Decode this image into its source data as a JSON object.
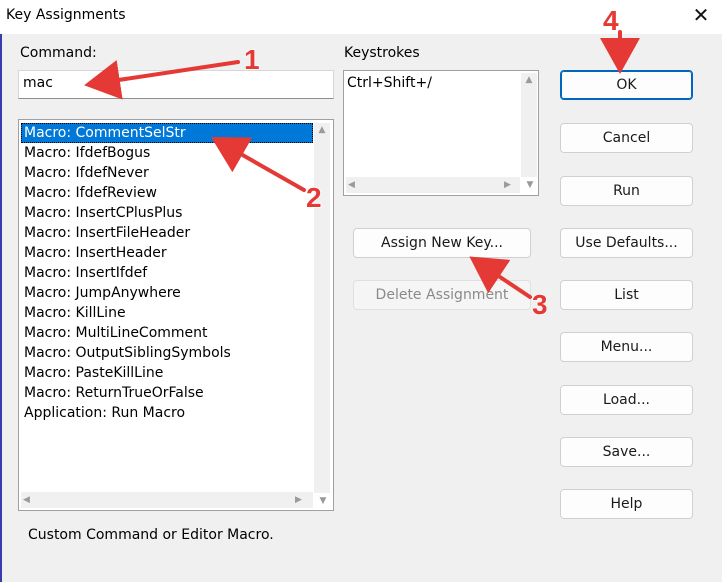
{
  "window": {
    "title": "Key Assignments"
  },
  "command": {
    "label": "Command:",
    "value": "mac"
  },
  "commands_list": {
    "selected_index": 0,
    "items": [
      "Macro: CommentSelStr",
      "Macro: IfdefBogus",
      "Macro: IfdefNever",
      "Macro: IfdefReview",
      "Macro: InsertCPlusPlus",
      "Macro: InsertFileHeader",
      "Macro: InsertHeader",
      "Macro: InsertIfdef",
      "Macro: JumpAnywhere",
      "Macro: KillLine",
      "Macro: MultiLineComment",
      "Macro: OutputSiblingSymbols",
      "Macro: PasteKillLine",
      "Macro: ReturnTrueOrFalse",
      "Application: Run Macro"
    ]
  },
  "keystrokes": {
    "label": "Keystrokes",
    "items": [
      "Ctrl+Shift+/"
    ]
  },
  "middle_buttons": {
    "assign": "Assign New Key...",
    "delete": "Delete Assignment"
  },
  "right_buttons": {
    "ok": "OK",
    "cancel": "Cancel",
    "run": "Run",
    "use_defaults": "Use Defaults...",
    "list": "List",
    "menu": "Menu...",
    "load": "Load...",
    "save": "Save...",
    "help": "Help"
  },
  "description": "Custom Command or Editor Macro.",
  "annotations": {
    "n1": "1",
    "n2": "2",
    "n3": "3",
    "n4": "4",
    "color": "#e53935"
  }
}
